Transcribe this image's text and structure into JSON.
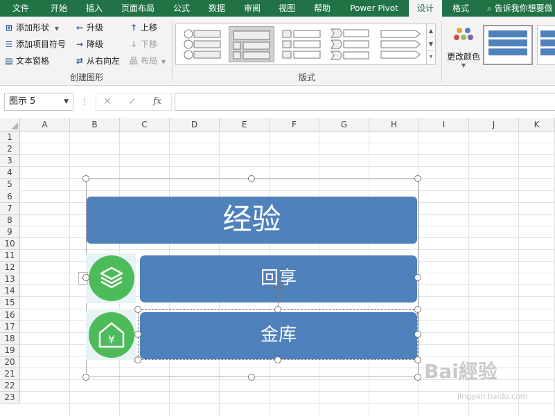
{
  "ribbon_tabs": [
    "文件",
    "开始",
    "插入",
    "页面布局",
    "公式",
    "数据",
    "审阅",
    "视图",
    "帮助",
    "Power Pivot",
    "设计",
    "格式"
  ],
  "active_tab": "设计",
  "tell_me": "告诉我你想要做",
  "create_graphic": {
    "add_shape": "添加形状",
    "add_bullet": "添加项目符号",
    "text_pane": "文本窗格",
    "promote": "升级",
    "demote": "降级",
    "right_to_left": "从右向左",
    "move_up": "上移",
    "move_down": "下移",
    "layout": "布局",
    "group_label": "创建图形"
  },
  "layouts": {
    "group_label": "版式"
  },
  "change_colors": "更改颜色",
  "name_box": "图示 5",
  "formula_fx": "fx",
  "columns": [
    "A",
    "B",
    "C",
    "D",
    "E",
    "F",
    "G",
    "H",
    "I",
    "J",
    "K"
  ],
  "rows": [
    "1",
    "2",
    "3",
    "4",
    "5",
    "6",
    "7",
    "8",
    "9",
    "10",
    "11",
    "12",
    "13",
    "14",
    "15",
    "16",
    "17",
    "18",
    "19",
    "20",
    "21",
    "22",
    "23"
  ],
  "smartart": {
    "title": "经验",
    "items": [
      "回享",
      "金库"
    ],
    "item_icons": [
      "layers-icon",
      "home-yuan-icon"
    ],
    "colors": {
      "box": "#4f81bd",
      "icon_circle": "#4dbb5a",
      "icon_bg": "#e7f3f4"
    }
  },
  "watermark": {
    "main": "Bai經验",
    "sub": "jingyan.baidu.com"
  },
  "colors": {
    "ribbon_green": "#217346",
    "ribbon_bg": "#f3f3f3"
  }
}
